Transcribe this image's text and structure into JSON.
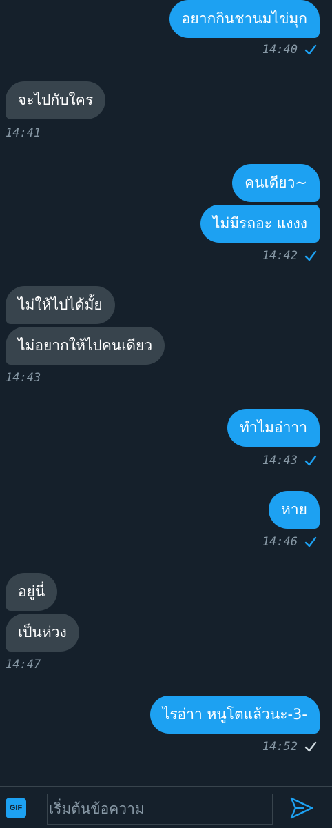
{
  "messages": [
    {
      "side": "sent",
      "text": "อยากกินชานมไข่มุก"
    },
    {
      "side": "recv",
      "text": "จะไปกับใคร"
    },
    {
      "side": "sent",
      "text": "คนเดียว~"
    },
    {
      "side": "sent",
      "text": "ไม่มีรถอะ แงงง"
    },
    {
      "side": "recv",
      "text": "ไม่ให้ไปได้มั้ย"
    },
    {
      "side": "recv",
      "text": "ไม่อยากให้ไปคนเดียว"
    },
    {
      "side": "sent",
      "text": "ทำไมอ่าาา"
    },
    {
      "side": "sent",
      "text": "หาย"
    },
    {
      "side": "recv",
      "text": "อยู่นี่"
    },
    {
      "side": "recv",
      "text": "เป็นห่วง"
    },
    {
      "side": "sent",
      "text": "ไรอ่าา หนูโตแล้วนะ-3-"
    }
  ],
  "timestamps": {
    "t1": "14:40",
    "t2": "14:41",
    "t3": "14:42",
    "t4": "14:43",
    "t5": "14:43",
    "t6": "14:46",
    "t7": "14:47",
    "t8": "14:52"
  },
  "colors": {
    "background": "#15202b",
    "sent_bubble": "#1da1f2",
    "received_bubble": "#38444d",
    "read_check": "#1da1f2",
    "unread_check": "#8899a6"
  },
  "composer": {
    "gif_label": "GIF",
    "placeholder": "เริ่มต้นข้อความ",
    "send_icon": "send-icon"
  }
}
